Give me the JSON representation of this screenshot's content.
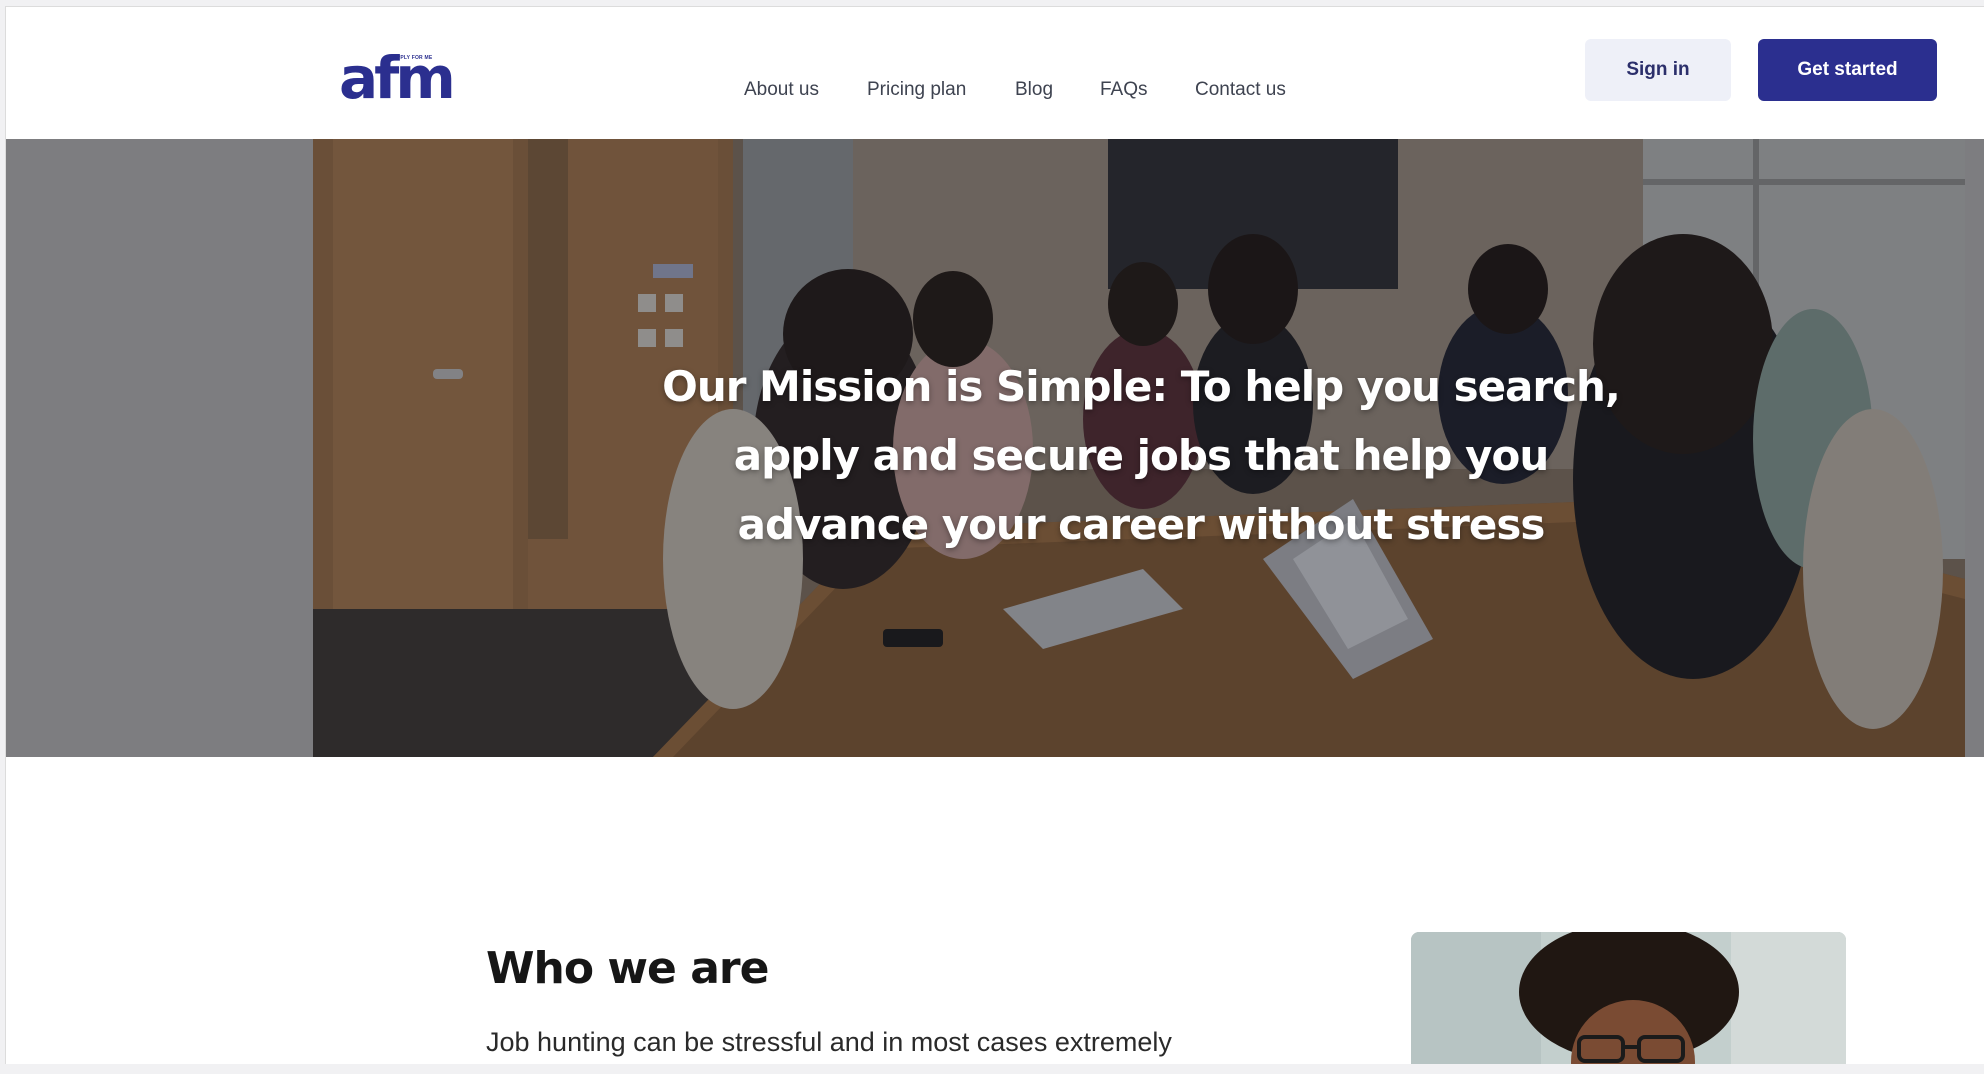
{
  "brand": {
    "logo_text": "afm",
    "logo_tagline": "APPLY FOR ME",
    "primary_color": "#2b2f8f"
  },
  "nav": {
    "items": [
      {
        "label": "About us"
      },
      {
        "label": "Pricing plan"
      },
      {
        "label": "Blog"
      },
      {
        "label": "FAQs"
      },
      {
        "label": "Contact us"
      }
    ]
  },
  "actions": {
    "signin_label": "Sign in",
    "get_started_label": "Get started"
  },
  "hero": {
    "title_lines": [
      "Our Mission is Simple: To help you search,",
      "apply and secure jobs that help you",
      "advance your career without stress"
    ]
  },
  "who": {
    "title": "Who we are",
    "body": "Job hunting can be stressful and in most cases extremely"
  }
}
